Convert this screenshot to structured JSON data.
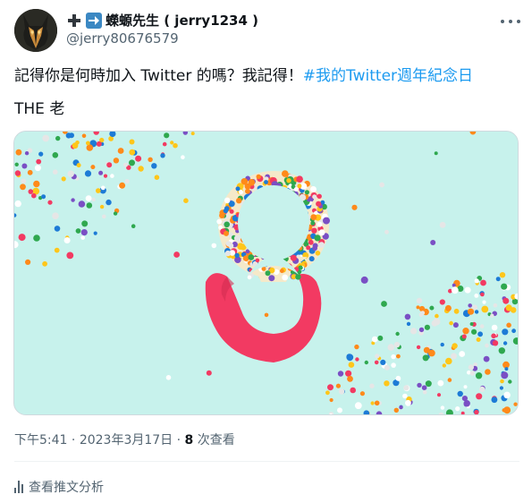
{
  "author": {
    "display_name": "蠑螈先生 ( jerry1234 )",
    "handle": "@jerry80676579",
    "avatar_icon": "avatar-mask-icon",
    "name_emoji": [
      "plus-emoji-icon",
      "right-arrow-emoji-icon"
    ]
  },
  "tweet": {
    "text": "記得你是何時加入 Twitter 的嗎？我記得！",
    "hashtag": "#我的Twitter週年紀念日",
    "line2": "THE 老"
  },
  "media": {
    "description_icon": "confetti-number-8-image",
    "colors": {
      "background": "#c7f2ec",
      "ring_red": "#f23a62",
      "hashtag_blue": "#1d9bf0"
    }
  },
  "meta": {
    "time": "下午5:41",
    "separator": "·",
    "date": "2023年3月17日",
    "views_count": "8",
    "views_label": "次查看"
  },
  "actions": {
    "analytics_label": "查看推文分析",
    "analytics_icon": "analytics-bar-icon",
    "more_icon": "more-dots-icon"
  }
}
